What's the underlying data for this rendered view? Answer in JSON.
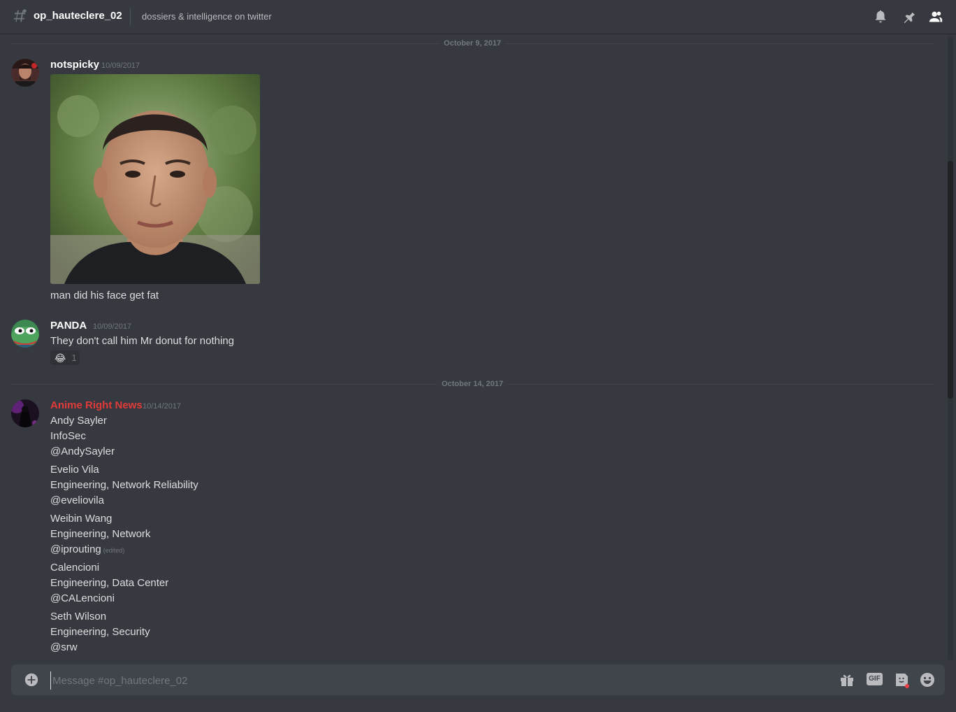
{
  "header": {
    "channel_name": "op_hauteclere_02",
    "topic": "dossiers & intelligence on twitter",
    "icons": [
      "hash-icon",
      "bell-icon",
      "pin-icon",
      "members-icon"
    ]
  },
  "dividers": [
    {
      "label": "October 9, 2017"
    },
    {
      "label": "October 14, 2017"
    }
  ],
  "messages": [
    {
      "username": "notspicky",
      "timestamp": "10/09/2017",
      "username_color": "#ffffff",
      "lines": [
        "man did his face get fat"
      ]
    },
    {
      "username": "PANDA",
      "timestamp": "10/09/2017",
      "username_color": "#ffffff",
      "lines": [
        "They don't call him Mr donut for nothing"
      ],
      "reaction": {
        "emoji": "😂",
        "count": "1"
      }
    },
    {
      "username": "Anime Right News",
      "timestamp": "10/14/2017",
      "username_color": "#e03a3a",
      "groups": [
        [
          "Andy Sayler",
          "InfoSec",
          "@AndySayler"
        ],
        [
          "Evelio Vila",
          "Engineering, Network Reliability",
          "@eveliovila"
        ],
        [
          "Weibin Wang",
          "Engineering, Network",
          "@iprouting"
        ],
        [
          "Calencioni",
          "Engineering, Data Center",
          "@CALencioni"
        ],
        [
          "Seth Wilson",
          "Engineering, Security",
          "@srw"
        ]
      ],
      "edited_label": "(edited)"
    }
  ],
  "composer": {
    "placeholder": "Message #op_hauteclere_02",
    "gif_label": "GIF",
    "icons": [
      "add-attachment-icon",
      "gift-icon",
      "gif-icon",
      "sticker-icon",
      "emoji-icon"
    ]
  },
  "colors": {
    "background": "#36393f",
    "composer": "#40444b",
    "muted": "#72767d",
    "text": "#dcddde",
    "accent_red": "#e03a3a"
  }
}
